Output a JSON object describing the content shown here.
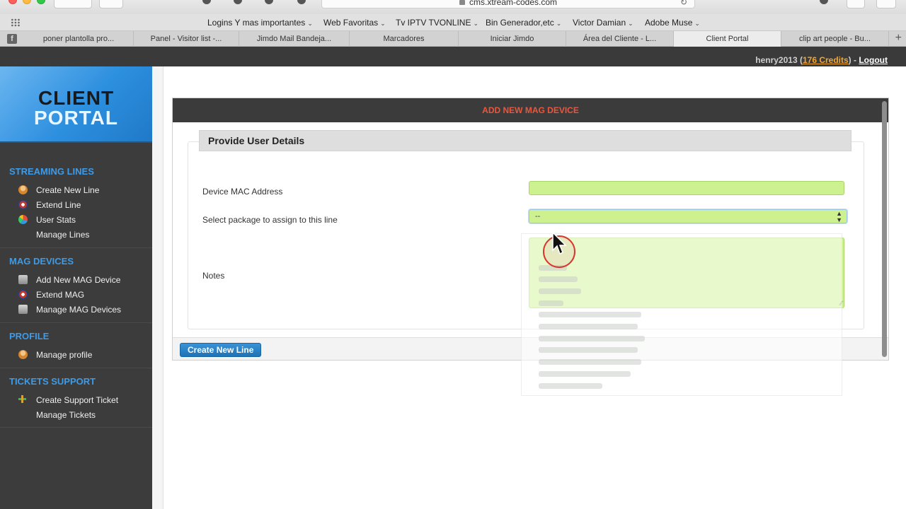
{
  "browser": {
    "url": "cms.xtream-codes.com",
    "bookmarks": [
      "Logins Y mas importantes",
      "Web Favoritas",
      "Tv IPTV TVONLINE",
      "Bin Generador,etc",
      "Victor Damian",
      "Adobe Muse"
    ],
    "tabs": [
      "poner plantolla pro...",
      "Panel - Visitor list -...",
      "Jimdo Mail Bandeja...",
      "Marcadores",
      "Iniciar Jimdo",
      "Área del Cliente - L...",
      "Client Portal",
      "clip art people - Bu..."
    ],
    "active_tab": "Client Portal"
  },
  "header": {
    "username": "henry2013",
    "credits_label": "176 Credits",
    "logout_label": "Logout"
  },
  "sidebar": {
    "logo_line1": "CLIENT",
    "logo_line2": "PORTAL",
    "sections": [
      {
        "title": "STREAMING LINES",
        "items": [
          "Create New Line",
          "Extend Line",
          "User Stats",
          "Manage Lines"
        ]
      },
      {
        "title": "MAG DEVICES",
        "items": [
          "Add New MAG Device",
          "Extend MAG",
          "Manage MAG Devices"
        ]
      },
      {
        "title": "PROFILE",
        "items": [
          "Manage profile"
        ]
      },
      {
        "title": "TICKETS SUPPORT",
        "items": [
          "Create Support Ticket",
          "Manage Tickets"
        ]
      }
    ]
  },
  "main": {
    "panel_title": "ADD NEW MAG DEVICE",
    "section_title": "Provide User Details",
    "fields": {
      "mac_label": "Device MAC Address",
      "mac_value": "",
      "package_label": "Select package to assign to this line",
      "package_selected": "--",
      "notes_label": "Notes",
      "notes_value": ""
    },
    "submit_label": "Create New Line"
  },
  "colors": {
    "accent_blue": "#3d9be8",
    "panel_title_orange": "#e9573f",
    "credits_orange": "#f3a732",
    "input_green": "#cdf18e",
    "button_blue": "#1f73b7"
  }
}
